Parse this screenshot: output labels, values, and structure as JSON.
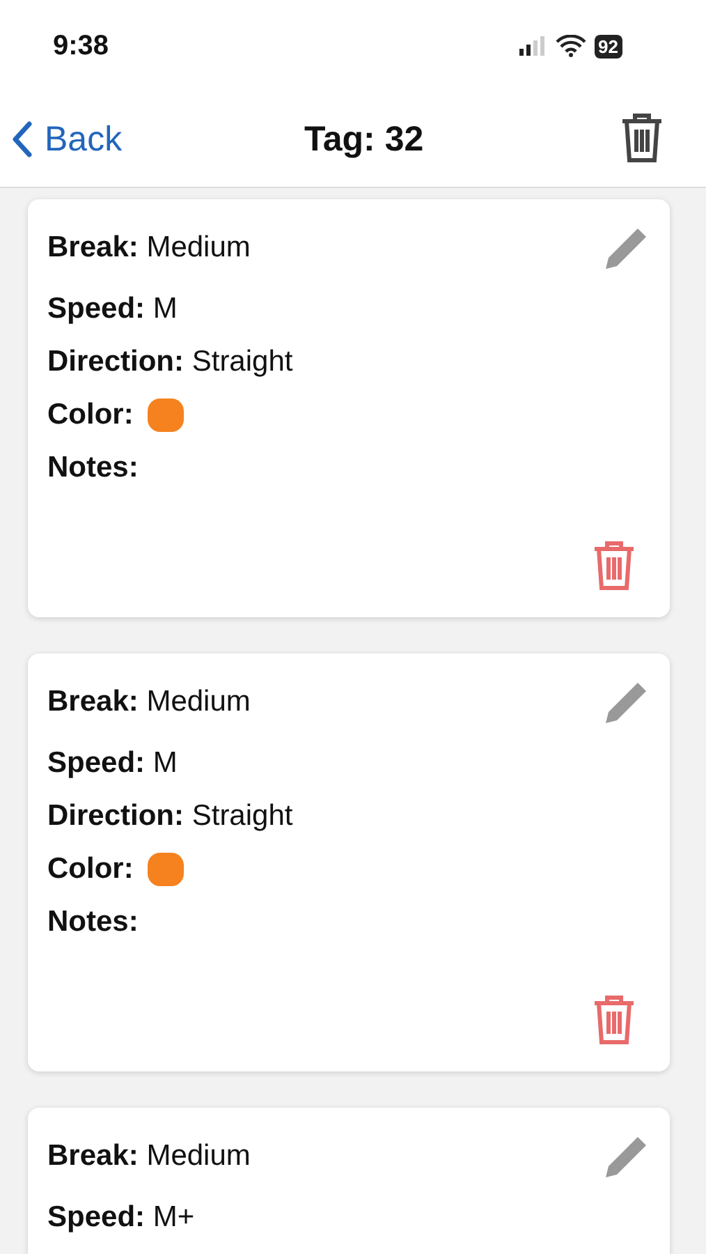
{
  "status_bar": {
    "time": "9:38",
    "battery": "92"
  },
  "nav": {
    "back": "Back",
    "title": "Tag: 32"
  },
  "cards": [
    {
      "fields": [
        {
          "kind": "text",
          "text": "**Break:** Medium"
        },
        {
          "kind": "text",
          "text": "**Speed:** M"
        },
        {
          "kind": "text",
          "text": "**Direction:** Straight"
        },
        {
          "kind": "color",
          "text": "**Color:**",
          "color": "#f5821f"
        },
        {
          "kind": "text",
          "text": "**Notes:**"
        }
      ]
    },
    {
      "fields": [
        {
          "kind": "text",
          "text": "**Break:** Medium"
        },
        {
          "kind": "text",
          "text": "**Speed:** M"
        },
        {
          "kind": "text",
          "text": "**Direction:** Straight"
        },
        {
          "kind": "color",
          "text": "**Color:**",
          "color": "#f5821f"
        },
        {
          "kind": "text",
          "text": "**Notes:**"
        }
      ]
    },
    {
      "cut_off": true,
      "fields": [
        {
          "kind": "text",
          "text": "**Break:** Medium"
        },
        {
          "kind": "text",
          "text": "**Speed:** M+"
        }
      ]
    }
  ]
}
